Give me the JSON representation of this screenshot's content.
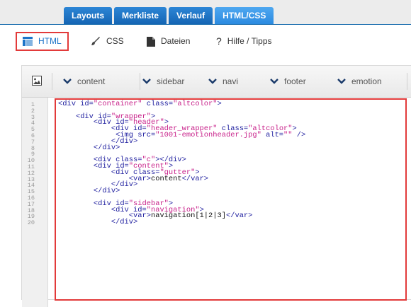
{
  "top_tabs": [
    {
      "label": "Layouts",
      "active": false
    },
    {
      "label": "Merkliste",
      "active": false
    },
    {
      "label": "Verlauf",
      "active": false
    },
    {
      "label": "HTML/CSS",
      "active": true
    }
  ],
  "sub_tabs": [
    {
      "label": "HTML",
      "icon": "html-layout-icon",
      "active": true
    },
    {
      "label": "CSS",
      "icon": "brush-icon",
      "active": false
    },
    {
      "label": "Dateien",
      "icon": "file-icon",
      "active": false
    },
    {
      "label": "Hilfe / Tipps",
      "icon": "question-mark-icon",
      "active": false
    }
  ],
  "editor_toolbar": {
    "image_button_icon": "image-icon",
    "dropdowns": [
      {
        "label": "content",
        "icon": "chevron-down-icon"
      },
      {
        "label": "sidebar",
        "icon": "chevron-down-icon"
      },
      {
        "label": "navi",
        "icon": "chevron-down-icon"
      },
      {
        "label": "footer",
        "icon": "chevron-down-icon"
      },
      {
        "label": "emotion",
        "icon": "chevron-down-icon"
      }
    ]
  },
  "colors": {
    "tab_blue": "#1565b4",
    "tab_active": "#2b8ae0",
    "highlight_red": "#e23a3a",
    "code_tag": "#1c1c9e",
    "code_string": "#c8218a"
  },
  "code_lines": [
    {
      "n": "1",
      "tokens": [
        [
          "t",
          "<div "
        ],
        [
          "a",
          "id="
        ],
        [
          "v",
          "\"container\""
        ],
        [
          "a",
          " class="
        ],
        [
          "v",
          "\"altcolor\""
        ],
        [
          "t",
          ">"
        ]
      ]
    },
    {
      "n": "2",
      "tokens": []
    },
    {
      "n": "3",
      "tokens": [
        [
          "tx",
          "    "
        ],
        [
          "t",
          "<div "
        ],
        [
          "a",
          "id="
        ],
        [
          "v",
          "\"wrapper\""
        ],
        [
          "t",
          ">"
        ]
      ]
    },
    {
      "n": "4",
      "tokens": [
        [
          "tx",
          "        "
        ],
        [
          "t",
          "<div "
        ],
        [
          "a",
          "id="
        ],
        [
          "v",
          "\"header\""
        ],
        [
          "t",
          ">"
        ]
      ]
    },
    {
      "n": "5",
      "tokens": [
        [
          "tx",
          "            "
        ],
        [
          "t",
          "<div "
        ],
        [
          "a",
          "id="
        ],
        [
          "v",
          "\"header_wrapper\""
        ],
        [
          "a",
          " class="
        ],
        [
          "v",
          "\"altcolor\""
        ],
        [
          "t",
          ">"
        ]
      ]
    },
    {
      "n": "6",
      "tokens": [
        [
          "tx",
          "             "
        ],
        [
          "t",
          "<img "
        ],
        [
          "a",
          "src="
        ],
        [
          "v",
          "\"1001-emotionheader.jpg\""
        ],
        [
          "a",
          " alt="
        ],
        [
          "v",
          "\"\""
        ],
        [
          "t",
          " />"
        ]
      ]
    },
    {
      "n": "7",
      "tokens": [
        [
          "tx",
          "            "
        ],
        [
          "t",
          "</div>"
        ]
      ]
    },
    {
      "n": "8",
      "tokens": [
        [
          "tx",
          "        "
        ],
        [
          "t",
          "</div>"
        ]
      ]
    },
    {
      "n": "9",
      "tokens": []
    },
    {
      "n": "10",
      "tokens": [
        [
          "tx",
          "        "
        ],
        [
          "t",
          "<div "
        ],
        [
          "a",
          "class="
        ],
        [
          "v",
          "\"c\""
        ],
        [
          "t",
          "></div>"
        ]
      ]
    },
    {
      "n": "11",
      "tokens": [
        [
          "tx",
          "        "
        ],
        [
          "t",
          "<div "
        ],
        [
          "a",
          "id="
        ],
        [
          "v",
          "\"content\""
        ],
        [
          "t",
          ">"
        ]
      ]
    },
    {
      "n": "12",
      "tokens": [
        [
          "tx",
          "            "
        ],
        [
          "t",
          "<div "
        ],
        [
          "a",
          "class="
        ],
        [
          "v",
          "\"gutter\""
        ],
        [
          "t",
          ">"
        ]
      ]
    },
    {
      "n": "13",
      "tokens": [
        [
          "tx",
          "                "
        ],
        [
          "t",
          "<var>"
        ],
        [
          "tx",
          "content"
        ],
        [
          "t",
          "</var>"
        ]
      ]
    },
    {
      "n": "14",
      "tokens": [
        [
          "tx",
          "            "
        ],
        [
          "t",
          "</div>"
        ]
      ]
    },
    {
      "n": "15",
      "tokens": [
        [
          "tx",
          "        "
        ],
        [
          "t",
          "</div>"
        ]
      ]
    },
    {
      "n": "16",
      "tokens": []
    },
    {
      "n": "17",
      "tokens": [
        [
          "tx",
          "        "
        ],
        [
          "t",
          "<div "
        ],
        [
          "a",
          "id="
        ],
        [
          "v",
          "\"sidebar\""
        ],
        [
          "t",
          ">"
        ]
      ]
    },
    {
      "n": "18",
      "tokens": [
        [
          "tx",
          "            "
        ],
        [
          "t",
          "<div "
        ],
        [
          "a",
          "id="
        ],
        [
          "v",
          "\"navigation\""
        ],
        [
          "t",
          ">"
        ]
      ]
    },
    {
      "n": "19",
      "tokens": [
        [
          "tx",
          "                "
        ],
        [
          "t",
          "<var>"
        ],
        [
          "tx",
          "navigation[1|2|3]"
        ],
        [
          "t",
          "</var>"
        ]
      ]
    },
    {
      "n": "20",
      "tokens": [
        [
          "tx",
          "            "
        ],
        [
          "t",
          "</div>"
        ]
      ]
    }
  ]
}
